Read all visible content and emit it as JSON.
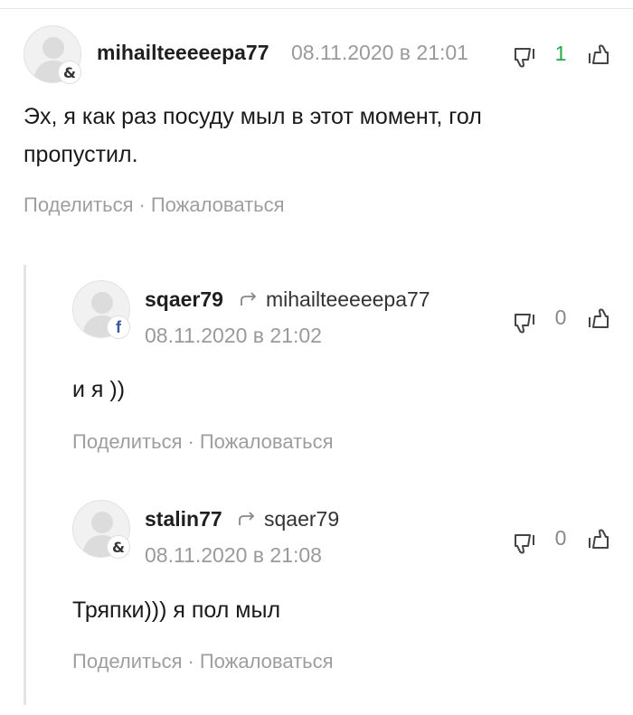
{
  "comments": [
    {
      "username": "mihailteeeeepa77",
      "date": "08.11.2020 в 21:01",
      "provider_icon": "ampersand-icon",
      "text": "Эх, я как раз посуду мыл в этот момент, гол пропустил.",
      "votes": "1",
      "share_label": "Поделиться",
      "separator": "·",
      "report_label": "Пожаловаться"
    },
    {
      "username": "sqaer79",
      "reply_to": "mihailteeeeepa77",
      "date": "08.11.2020 в 21:02",
      "provider_icon": "facebook-icon",
      "text": "и я ))",
      "votes": "0",
      "share_label": "Поделиться",
      "separator": "·",
      "report_label": "Пожаловаться"
    },
    {
      "username": "stalin77",
      "reply_to": "sqaer79",
      "date": "08.11.2020 в 21:08",
      "provider_icon": "ampersand-icon",
      "text": "Тряпки))) я пол мыл",
      "votes": "0",
      "share_label": "Поделиться",
      "separator": "·",
      "report_label": "Пожаловаться"
    }
  ],
  "icons": {
    "ampersand": "&",
    "facebook": "f"
  },
  "colors": {
    "positive_votes": "#27a74a",
    "muted_text": "#9e9e9e",
    "username": "#1f1f1f"
  }
}
